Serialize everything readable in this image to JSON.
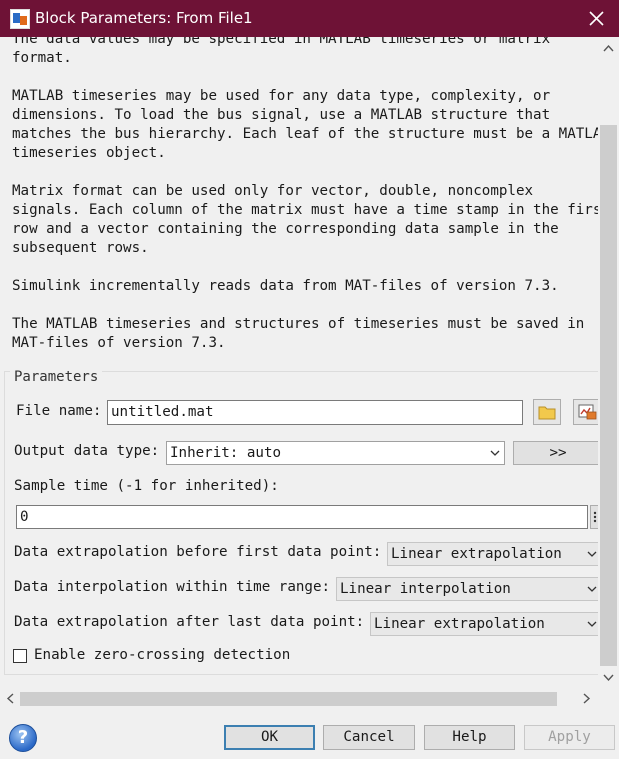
{
  "window": {
    "title": "Block Parameters: From File1",
    "close_glyph": "✕"
  },
  "description": {
    "lines_1": "The data values may be specified in MATLAB timeseries or matrix\nformat.",
    "lines_2": "MATLAB timeseries may be used for any data type, complexity, or\ndimensions. To load the bus signal, use a MATLAB structure that\nmatches the bus hierarchy. Each leaf of the structure must be a MATLAB\ntimeseries object.",
    "lines_3": "Matrix format can be used only for vector, double, noncomplex\nsignals. Each column of the matrix must have a time stamp in the first\nrow and a vector containing the corresponding data sample in the\nsubsequent rows.",
    "lines_4": "Simulink incrementally reads data from MAT-files of version 7.3.",
    "lines_5": "The MATLAB timeseries and structures of timeseries must be saved in\nMAT-files of version 7.3."
  },
  "parameters": {
    "group_label": "Parameters",
    "file_name_label": "File name:",
    "file_name_value": "untitled.mat",
    "output_type_label": "Output data type:",
    "output_type_value": "Inherit: auto",
    "data_type_assistant_label": ">>",
    "sample_time_label": "Sample time (-1 for inherited):",
    "sample_time_value": "0",
    "extrap_before_label": "Data extrapolation before first data point:",
    "extrap_before_value": "Linear extrapolation",
    "interp_label": "Data interpolation within time range:",
    "interp_value": "Linear interpolation",
    "extrap_after_label": "Data extrapolation after last data point:",
    "extrap_after_value": "Linear extrapolation",
    "zero_crossing_label": "Enable zero-crossing detection",
    "zero_crossing_checked": false
  },
  "buttons": {
    "ok": "OK",
    "cancel": "Cancel",
    "help": "Help",
    "apply": "Apply",
    "help_icon_glyph": "?"
  },
  "colors": {
    "titlebar": "#6e1236",
    "default_button_border": "#3c7fb1"
  }
}
